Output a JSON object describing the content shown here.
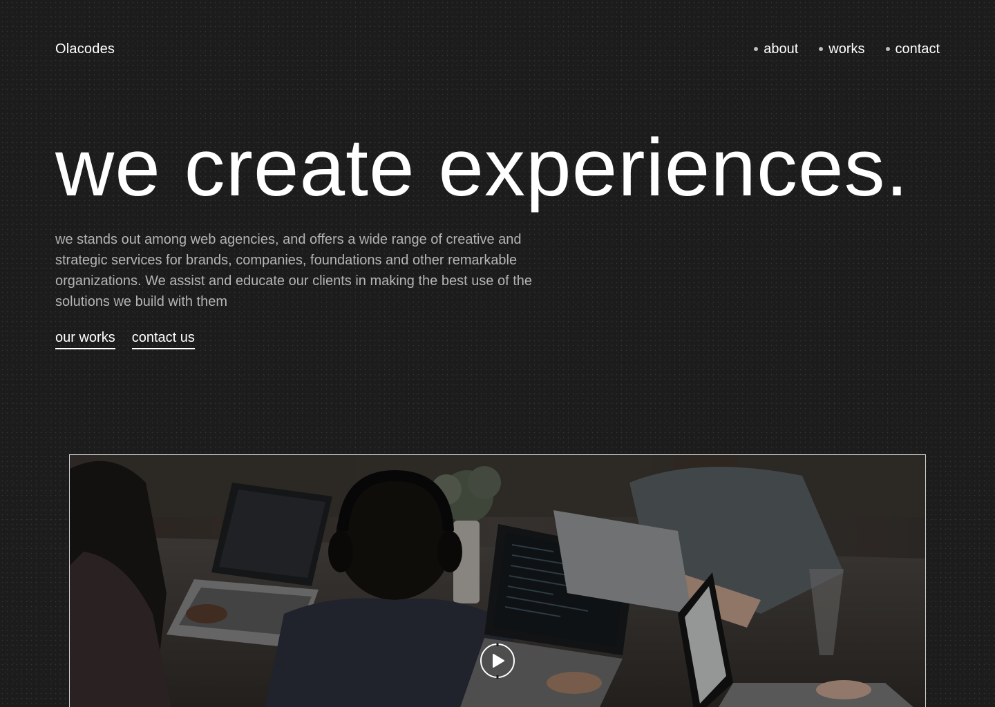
{
  "header": {
    "logo": "Olacodes",
    "nav": [
      {
        "label": "about"
      },
      {
        "label": "works"
      },
      {
        "label": "contact"
      }
    ]
  },
  "hero": {
    "title": "we create experiences.",
    "description": "we stands out among web agencies, and offers a wide range of creative and strategic services for brands, companies, foundations and other remarkable organizations. We assist and educate our clients in making the best use of the solutions we build with them",
    "cta": [
      {
        "label": "our works"
      },
      {
        "label": "contact us"
      }
    ]
  },
  "video": {
    "play_icon": "play-icon"
  },
  "colors": {
    "background": "#1d1c1c",
    "text": "#ffffff",
    "muted_text": "#b4b4b4",
    "nav_dot": "#bdbdbd"
  }
}
